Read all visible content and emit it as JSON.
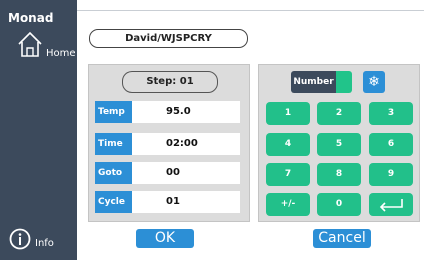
{
  "sidebar": {
    "brand": "Monad",
    "home_label": "Home",
    "info_label": "Info"
  },
  "profile": {
    "name": "David/WJSPCRY"
  },
  "program": {
    "step_label": "Step: 01",
    "params": [
      {
        "label": "Temp",
        "value": "95.0"
      },
      {
        "label": "Time",
        "value": "02:00"
      },
      {
        "label": "Goto",
        "value": "00"
      },
      {
        "label": "Cycle",
        "value": "01"
      }
    ]
  },
  "keypad": {
    "mode_label": "Number",
    "keys": [
      "1",
      "2",
      "3",
      "4",
      "5",
      "6",
      "7",
      "8",
      "9",
      "+/-",
      "0",
      ""
    ]
  },
  "actions": {
    "ok": "OK",
    "cancel": "Cancel"
  },
  "colors": {
    "sidebar": "#3c4a5c",
    "accent_blue": "#2c8fd6",
    "key_green": "#22c08a"
  }
}
